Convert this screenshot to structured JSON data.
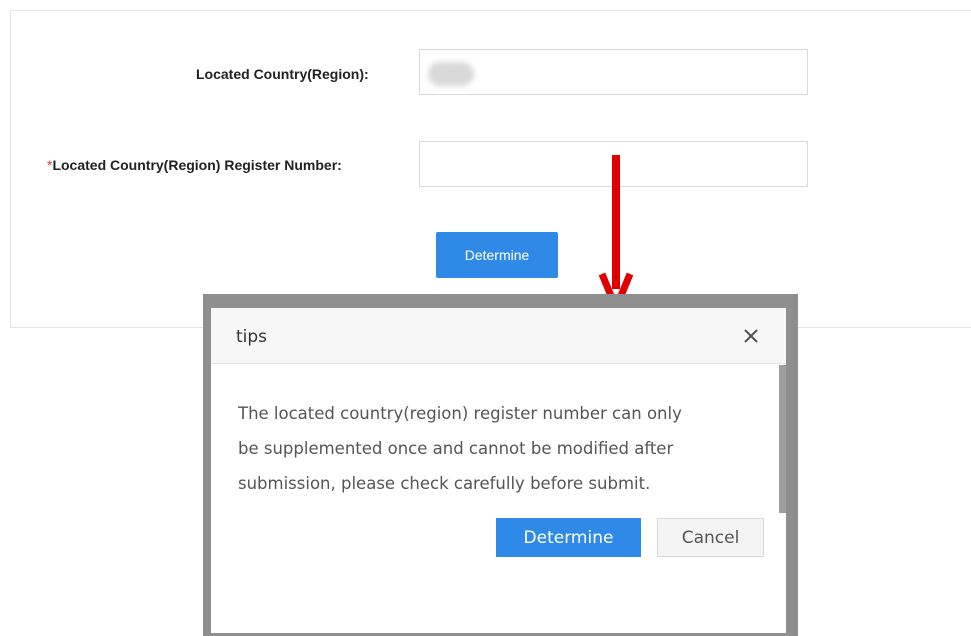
{
  "form": {
    "country_label": "Located Country(Region):",
    "register_required_mark": "*",
    "register_label": "Located Country(Region) Register Number:",
    "country_value": "",
    "register_value": "",
    "submit_label": "Determine"
  },
  "annotation": {
    "arrow_color": "#e00000"
  },
  "dialog": {
    "title": "tips",
    "close_icon": "close-icon",
    "message_lines": [
      "The located country(region) register number can only",
      "be supplemented once and cannot be modified after",
      "submission, please check carefully before submit."
    ],
    "confirm_label": "Determine",
    "cancel_label": "Cancel"
  },
  "colors": {
    "primary": "#2e8ae6",
    "required": "#e53935"
  }
}
